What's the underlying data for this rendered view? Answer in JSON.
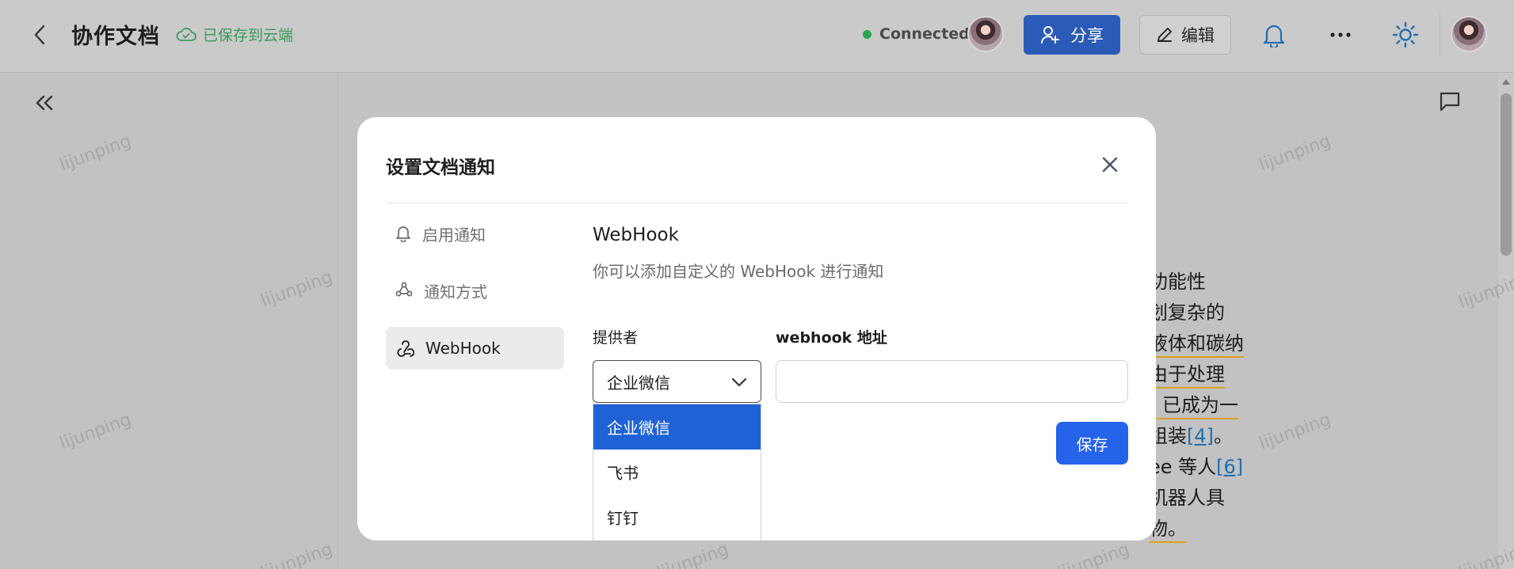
{
  "header": {
    "doc_title": "协作文档",
    "saved_status": "已保存到云端",
    "connection_status": "Connected",
    "share_label": "分享",
    "edit_label": "编辑"
  },
  "watermark_text": "lijunping",
  "background_doc": {
    "fragments": [
      "功能性",
      "划复杂的",
      "液体和碳纳",
      "由于处理",
      ") 已成为一",
      "组装",
      "ee 等人",
      "机器人具",
      "物。"
    ],
    "ref4": "[4]",
    "ref6": "[6]",
    "end_mark": "。"
  },
  "modal": {
    "title": "设置文档通知",
    "menu": [
      {
        "label": "启用通知",
        "icon": "bell-icon"
      },
      {
        "label": "通知方式",
        "icon": "share-nodes-icon"
      },
      {
        "label": "WebHook",
        "icon": "webhook-icon",
        "active": true
      }
    ],
    "section_title": "WebHook",
    "section_desc": "你可以添加自定义的 WebHook 进行通知",
    "provider_label": "提供者",
    "url_label": "webhook 地址",
    "provider_value": "企业微信",
    "url_value": "",
    "url_placeholder": "",
    "save_label": "保存",
    "provider_options": [
      "企业微信",
      "飞书",
      "钉钉"
    ]
  },
  "colors": {
    "primary": "#2563eb",
    "share_button": "#2b5bb8",
    "connected": "#2da44e",
    "saved": "#3a9a5b",
    "highlight_underline": "#d9a21b"
  }
}
